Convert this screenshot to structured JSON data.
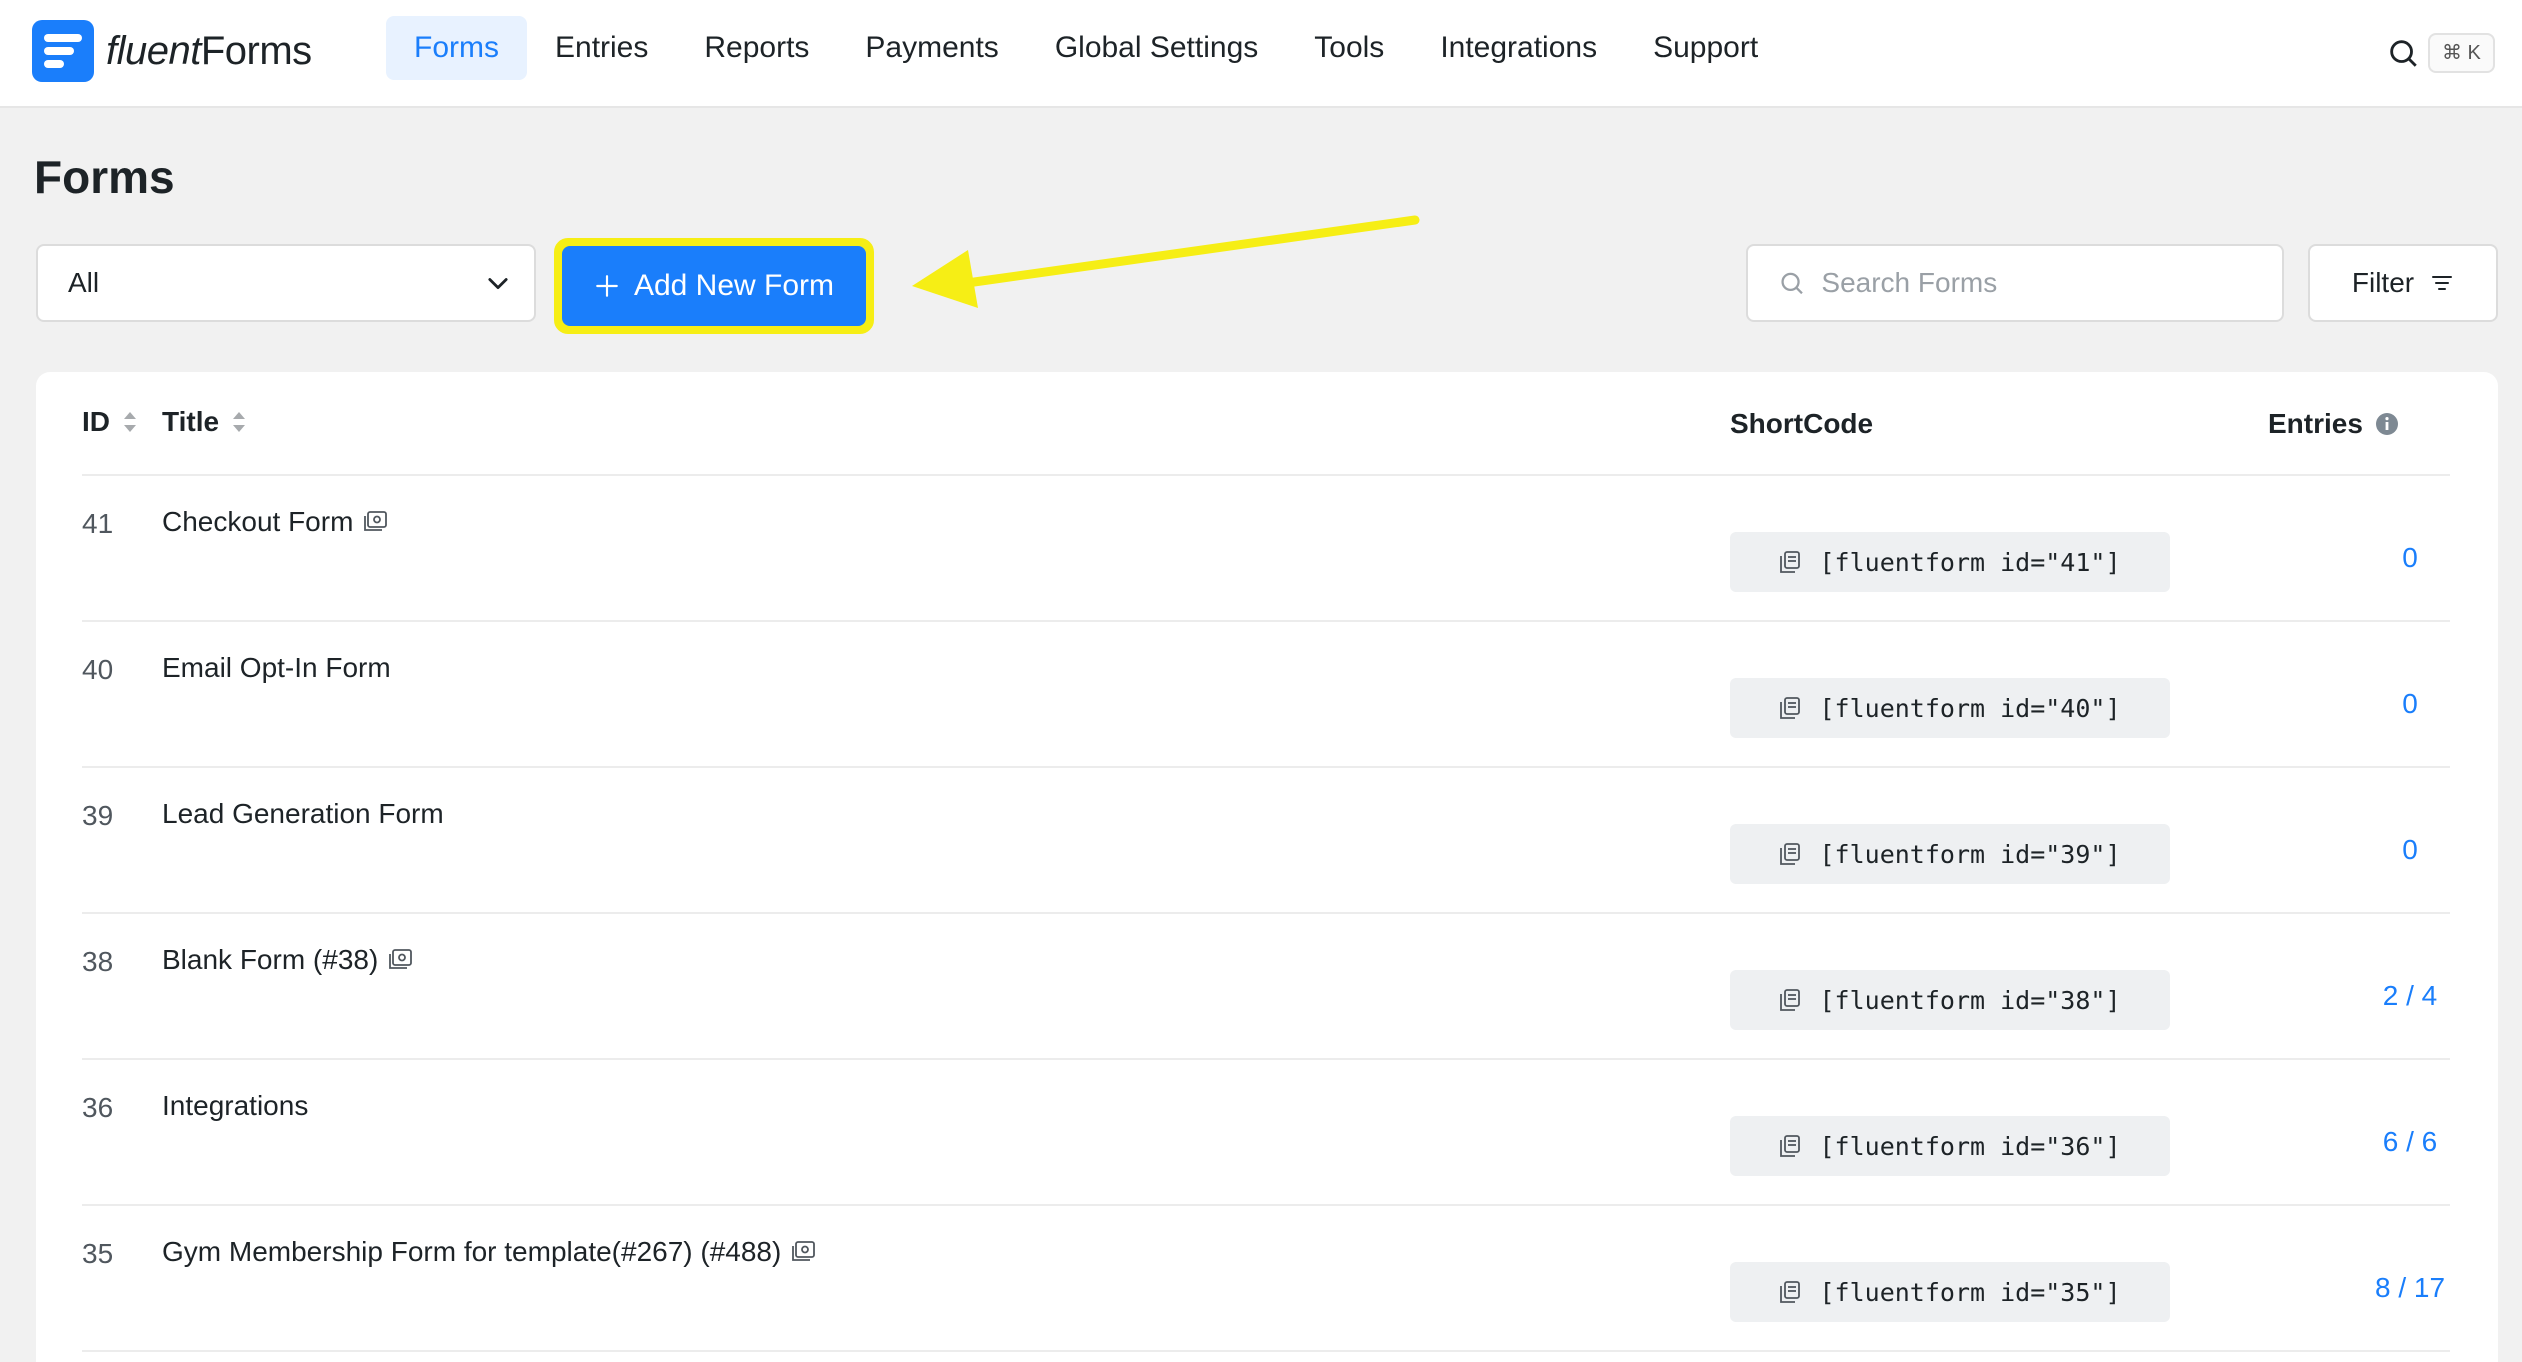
{
  "app": {
    "logo_part1": "fluent",
    "logo_part2": "Forms",
    "brand_color": "#1a7efb"
  },
  "nav": {
    "items": [
      {
        "label": "Forms",
        "active": true
      },
      {
        "label": "Entries"
      },
      {
        "label": "Reports"
      },
      {
        "label": "Payments"
      },
      {
        "label": "Global Settings"
      },
      {
        "label": "Tools"
      },
      {
        "label": "Integrations"
      },
      {
        "label": "Support"
      }
    ],
    "shortcut": "⌘ K"
  },
  "page": {
    "title": "Forms"
  },
  "toolbar": {
    "select_value": "All",
    "add_button_label": "Add New Form",
    "search_placeholder": "Search Forms",
    "filter_label": "Filter",
    "highlight_color": "#f6ee15"
  },
  "table": {
    "headers": {
      "id": "ID",
      "title": "Title",
      "shortcode": "ShortCode",
      "entries": "Entries"
    },
    "rows": [
      {
        "id": "41",
        "title": "Checkout Form",
        "has_icon": true,
        "shortcode": "[fluentform id=\"41\"]",
        "entries": "0"
      },
      {
        "id": "40",
        "title": "Email Opt-In Form",
        "has_icon": false,
        "shortcode": "[fluentform id=\"40\"]",
        "entries": "0"
      },
      {
        "id": "39",
        "title": "Lead Generation Form",
        "has_icon": false,
        "shortcode": "[fluentform id=\"39\"]",
        "entries": "0"
      },
      {
        "id": "38",
        "title": "Blank Form (#38)",
        "has_icon": true,
        "shortcode": "[fluentform id=\"38\"]",
        "entries": "2 / 4"
      },
      {
        "id": "36",
        "title": "Integrations",
        "has_icon": false,
        "shortcode": "[fluentform id=\"36\"]",
        "entries": "6 / 6"
      },
      {
        "id": "35",
        "title": "Gym Membership Form for template(#267) (#488)",
        "has_icon": true,
        "shortcode": "[fluentform id=\"35\"]",
        "entries": "8 / 17"
      }
    ]
  }
}
